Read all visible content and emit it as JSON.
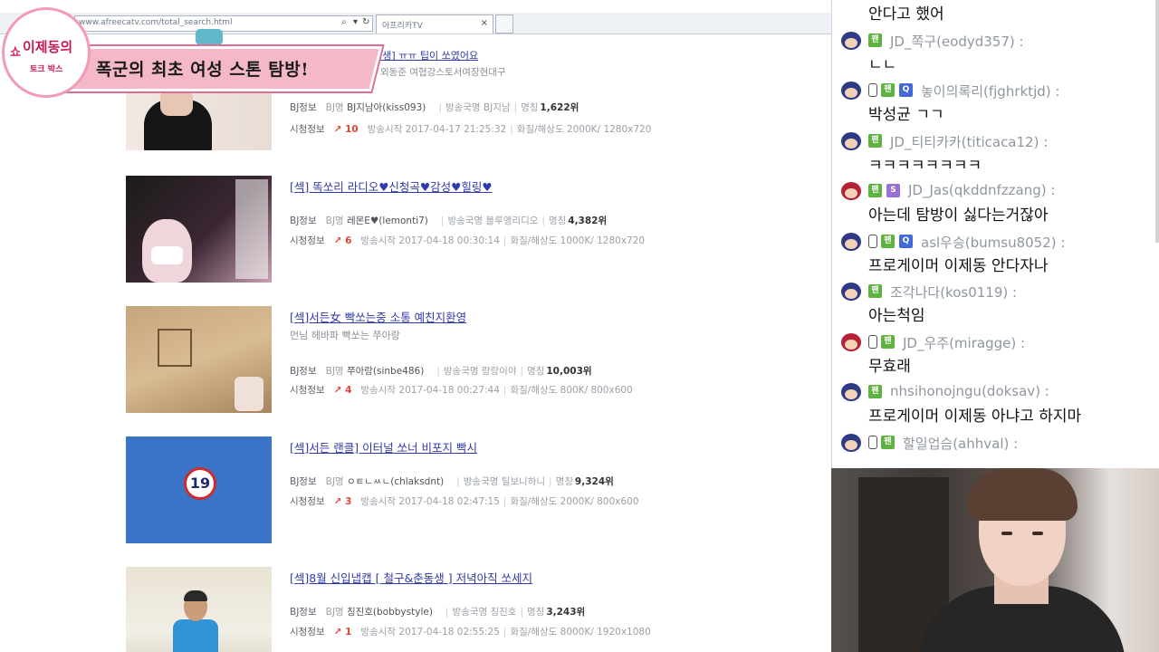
{
  "browser": {
    "address": "www.afreecatv.com/total_search.html",
    "tab_title": "아프리카TV",
    "overlay_badge_line1": "이제동의",
    "overlay_badge_line2": "토크 박스",
    "overlay_badge_side": "쇼",
    "overlay_title": "폭군의 최초 여성 스톤 탐방!",
    "partial_title": "[생] ㅠㅠ 팁이 쏘였어요",
    "partial_desc": "외동준 여협강스토서여장현대구"
  },
  "results": [
    {
      "title": "",
      "desc": "",
      "bj_label": "BJ정보",
      "bj_prefix": "BJ명",
      "bj_nick": "BJ지남아(kiss093)",
      "category": "방송국명  BJ지남",
      "views_label": "명칭",
      "views": "1,622위",
      "watch_label": "시청정보",
      "rank": "10",
      "start": "방송시작 2017-04-17 21:25:32",
      "quality": "화질/해상도 2000K/ 1280x720"
    },
    {
      "title": "[섹] 똑쏘리 라디오♥신청곡♥감성♥힐링♥",
      "desc": "",
      "bj_label": "BJ정보",
      "bj_prefix": "BJ명",
      "bj_nick": "레몬E♥(lemonti7)",
      "category": "방송국명  블루앵리디오",
      "views_label": "명칭",
      "views": "4,382위",
      "watch_label": "시청정보",
      "rank": "6",
      "start": "방송시작 2017-04-18 00:30:14",
      "quality": "화질/해상도 1000K/ 1280x720"
    },
    {
      "title": "[섹]서든女 빡쏘는중 소통 예친지환영",
      "desc": "먼님 헤바파 빡쏘는 쭈아랑",
      "bj_label": "BJ정보",
      "bj_prefix": "BJ명",
      "bj_nick": "쭈아랑(sinbe486)",
      "category": "방송국명  랑랑이야",
      "views_label": "명칭",
      "views": "10,003위",
      "watch_label": "시청정보",
      "rank": "4",
      "start": "방송시작 2017-04-18 00:27:44",
      "quality": "화질/해상도 800K/ 800x600"
    },
    {
      "title": "[섹]서든 랜클] 이터널 쏘너 비포지 빡시",
      "desc": "",
      "bj_label": "BJ정보",
      "bj_prefix": "BJ명",
      "bj_nick": "ㅇㅌㄴㅆㄴ(chlaksdnt)",
      "category": "방송국명  틸보니하니",
      "views_label": "명칭",
      "views": "9,324위",
      "watch_label": "시청정보",
      "rank": "3",
      "start": "방송시작 2017-04-18 02:47:15",
      "quality": "화질/해상도 2000K/ 800x600"
    },
    {
      "title": "[섹]8월 신입냅캡 [ 철구&춘동생 ] 저녁아직 쏘세지",
      "desc": "",
      "bj_label": "BJ정보",
      "bj_prefix": "BJ명",
      "bj_nick": "칭진호(bobbystyle)",
      "category": "방송국명  칭진호",
      "views_label": "명칭",
      "views": "3,243위",
      "watch_label": "시청정보",
      "rank": "1",
      "start": "방송시작 2017-04-18 02:55:25",
      "quality": "화질/해상도 8000K/ 1920x1080"
    }
  ],
  "thumb_badge": "19",
  "chat": [
    {
      "user": "",
      "text": "안다고 했어",
      "icons": []
    },
    {
      "user": "JD_쪽구(eodyd357) :",
      "text": "ㄴㄴ",
      "icons": [
        "fan"
      ]
    },
    {
      "user": "놓이의록리(fjghrktjd) :",
      "text": "박성균 ㄱㄱ",
      "icons": [
        "mob",
        "fan",
        "q"
      ]
    },
    {
      "user": "JD_티티카카(titicaca12) :",
      "text": "ㅋㅋㅋㅋㅋㅋㅋㅋ",
      "icons": [
        "fan"
      ]
    },
    {
      "user": "JD_Jas(qkddnfzzang) :",
      "text": "아는데 탐방이 싫다는거잖아",
      "icons": [
        "fan",
        "s"
      ]
    },
    {
      "user": "asl우승(bumsu8052) :",
      "text": "프로게이머 이제동 안다자나",
      "icons": [
        "mob",
        "fan",
        "q"
      ]
    },
    {
      "user": "조각나다(kos0119) :",
      "text": "아는척임",
      "icons": [
        "fan"
      ]
    },
    {
      "user": "JD_우주(miragge) :",
      "text": "무효래",
      "icons": [
        "mob",
        "fan"
      ]
    },
    {
      "user": "nhsihonojngu(doksav) :",
      "text": "프로게이머 이제동 아냐고 하지마",
      "icons": [
        "fan"
      ]
    },
    {
      "user": "할일업슴(ahhval) :",
      "text": "",
      "icons": [
        "mob",
        "fan"
      ]
    }
  ],
  "icon_glyphs": {
    "fan": "팬",
    "q": "Q",
    "s": "S"
  },
  "colors": {
    "link": "#2f3aaa",
    "rank": "#e2443a",
    "fan": "#5eb23f",
    "q": "#4169d9",
    "s": "#9a6fd6",
    "banner": "#f4b8c8"
  }
}
